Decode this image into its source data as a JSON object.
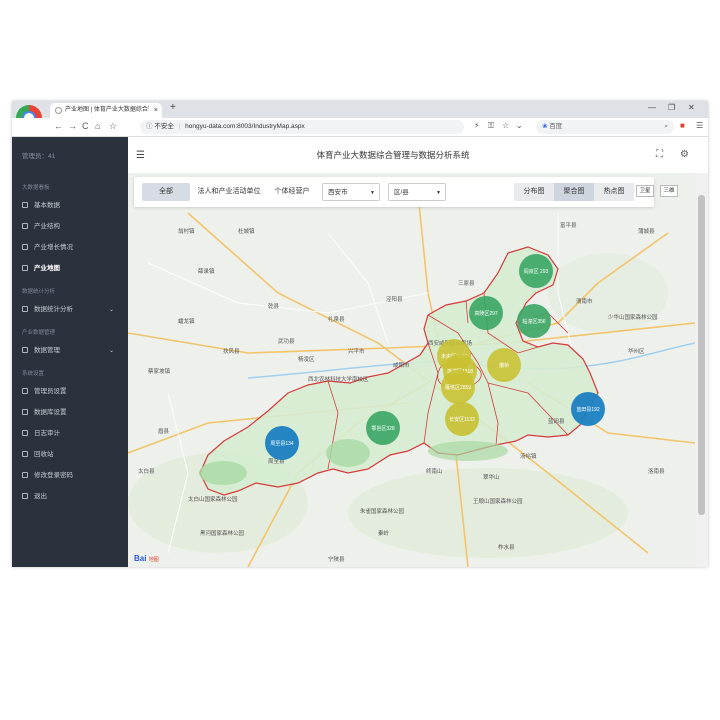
{
  "browser": {
    "tab_title": "产业地图 | 体育产业大数据综合管",
    "tab_close": "×",
    "new_tab": "+",
    "security": "不安全",
    "url": "hongyu-data.com:8003/IndustryMap.aspx",
    "search_engine": "百度",
    "nav": {
      "back": "←",
      "forward": "→",
      "reload": "C",
      "home": "⌂",
      "bookmark": "☆"
    }
  },
  "sidebar": {
    "user": "管理员：41",
    "sections": [
      {
        "title": "大数据看板",
        "items": [
          "基本数据",
          "产业结构",
          "产业增长情况",
          "产业地图"
        ]
      },
      {
        "title": "数据统计分析",
        "items": [
          "数据统计分析"
        ]
      },
      {
        "title": "产业数据管理",
        "items": [
          "数据管理"
        ]
      },
      {
        "title": "系统设置",
        "items": [
          "管理员设置",
          "数据库设置",
          "日志审计",
          "回收站",
          "修改登录密码",
          "退出"
        ]
      }
    ],
    "active_item": "产业地图"
  },
  "header": {
    "title": "体育产业大数据综合管理与数据分析系统"
  },
  "filter": {
    "all": "全部",
    "corp": "法人和产业活动单位",
    "individual": "个体经营户",
    "city_select": "西安市",
    "district_select": "区/县",
    "views": [
      "分布图",
      "聚合图",
      "热点图"
    ],
    "active_view": "聚合图",
    "map_types": [
      "卫星",
      "三维"
    ]
  },
  "map_labels": {
    "places": [
      "咸阳市",
      "渭南市",
      "西安咸阳国际机场",
      "西北农林科技大学南校区",
      "太白山国家森林公园",
      "黑河国家森林公园",
      "朱雀国家森林公园",
      "王顺山国家森林公园",
      "终南山",
      "翠华山",
      "礼泉县",
      "乾县",
      "泾阳县",
      "三原县",
      "富平县",
      "蒲城县",
      "华州区",
      "洛南县",
      "柞水县",
      "宁陕县",
      "周至县",
      "眉县",
      "太白县",
      "兴平市",
      "武功县",
      "杨凌区",
      "扶风县",
      "蓝田县",
      "秦岭",
      "少华山国家森林公园",
      "汤峪镇",
      "翁村镇",
      "杜城镇",
      "薛录镇",
      "蔡家坡镇",
      "蟠龙镇"
    ],
    "baidu": "Bai",
    "baidu_sub": "地图"
  },
  "clusters": [
    {
      "name": "阎良区",
      "count": 293,
      "color": "#3aa565"
    },
    {
      "name": "高陵区",
      "count": 297,
      "color": "#3aa565"
    },
    {
      "name": "临潼区",
      "count": 356,
      "color": "#3aa565"
    },
    {
      "name": "未央区",
      "count": 2084,
      "color": "#c8c030"
    },
    {
      "name": "灞桥区",
      "count": 0,
      "color": "#c8c030"
    },
    {
      "name": "新城区",
      "count": 0,
      "color": "#c8c030"
    },
    {
      "name": "莲湖区",
      "count": 1318,
      "color": "#c8c030"
    },
    {
      "name": "碑林区",
      "count": 1046,
      "color": "#c8c030"
    },
    {
      "name": "雁塔区",
      "count": 2859,
      "color": "#c8c030"
    },
    {
      "name": "长安区",
      "count": 1132,
      "color": "#c8c030"
    },
    {
      "name": "鄠邑区",
      "count": 328,
      "color": "#3aa565"
    },
    {
      "name": "周至县",
      "count": 134,
      "color": "#1b7fc2"
    },
    {
      "name": "蓝田县",
      "count": 192,
      "color": "#1b7fc2"
    }
  ],
  "cluster_texts": {
    "yanliang": "阎良区 293",
    "gaoling": "高陵区297",
    "lintong": "临潼区356",
    "weiyang": "未央区2084",
    "baqiao": "灞桥",
    "lianhu": "莲湖区1318",
    "beilin": "碑林区1046",
    "yanta": "雁塔区2859",
    "changan": "长安区1132",
    "huyi": "鄠邑区328",
    "zhouzhi": "周至县134",
    "lantian": "蓝田县192"
  }
}
